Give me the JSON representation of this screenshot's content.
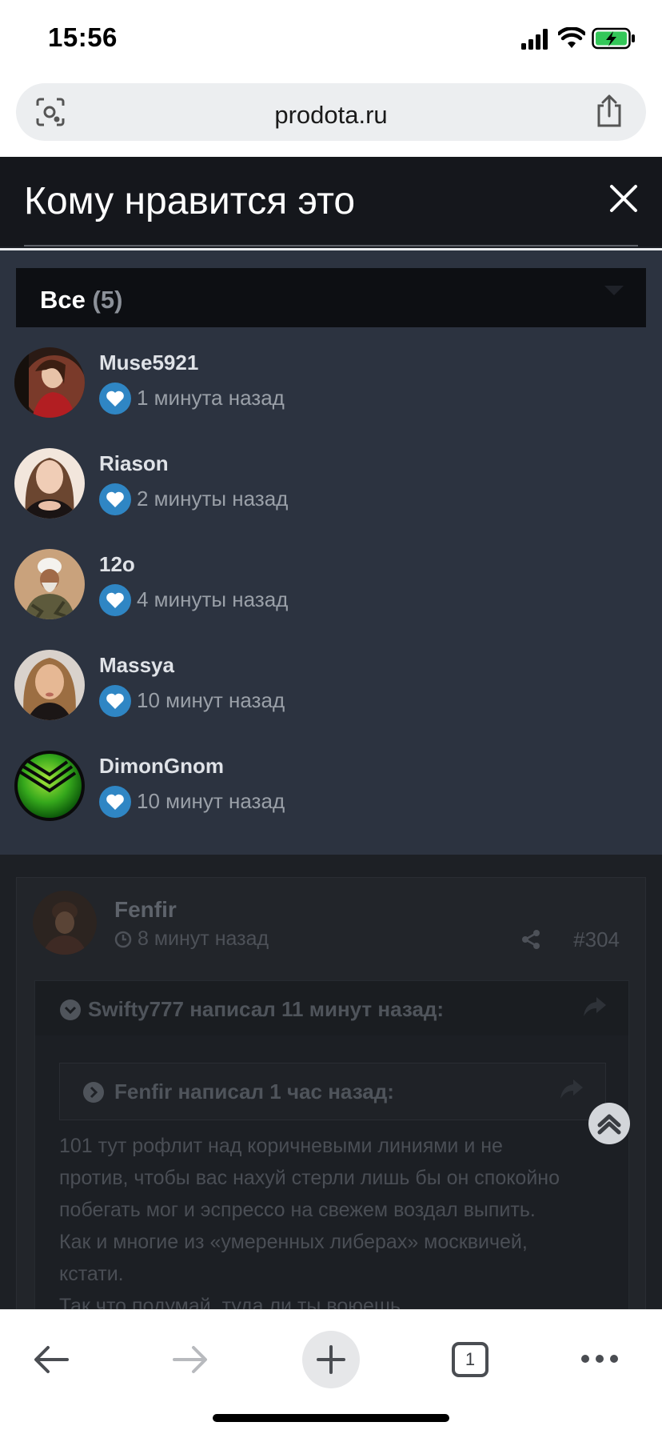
{
  "status_bar": {
    "time": "15:56"
  },
  "browser": {
    "url": "prodota.ru",
    "tab_count": "1",
    "icons": {
      "lens": "lens-icon",
      "share": "share-icon",
      "back": "back-arrow-icon",
      "forward": "forward-arrow-icon",
      "new_tab": "plus-icon",
      "more": "more-dots-icon"
    }
  },
  "modal": {
    "title": "Кому нравится это",
    "filter": {
      "label": "Все",
      "count": "(5)"
    },
    "likers": [
      {
        "name": "Muse5921",
        "time": "1 минута назад"
      },
      {
        "name": "Riason",
        "time": "2 минуты назад"
      },
      {
        "name": "12o",
        "time": "4 минуты назад"
      },
      {
        "name": "Massya",
        "time": "10 минут назад"
      },
      {
        "name": "DimonGnom",
        "time": "10 минут назад"
      }
    ]
  },
  "post": {
    "author": "Fenfir",
    "time": "8 минут назад",
    "number": "#304",
    "quote_outer": {
      "author": "Swifty777",
      "suffix": "написал 11 минут назад:"
    },
    "quote_inner": {
      "author": "Fenfir",
      "suffix": "написал 1 час назад:"
    },
    "body": "101 тут рофлит над коричневыми линиями и не против, чтобы вас нахуй стерли лишь бы он спокойно побегать мог и эспрессо на свежем воздал выпить. Как и многие из «умеренных либерах» москвичей, кстати.",
    "body_cut": "Так что подумай, туда ли ты воюешь"
  },
  "colors": {
    "like_badge": "#2f86c4",
    "modal_body": "#2c3340",
    "modal_header": "#15171c"
  }
}
